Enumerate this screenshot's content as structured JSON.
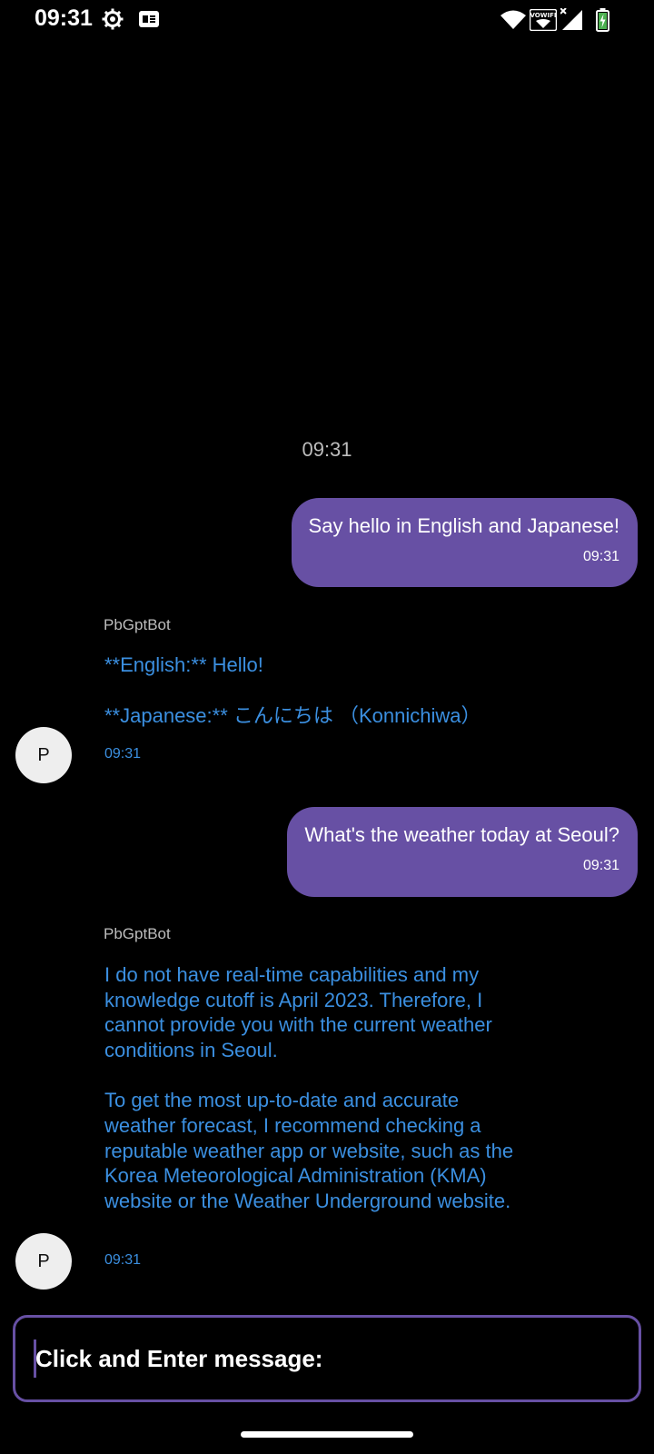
{
  "status_bar": {
    "time": "09:31",
    "icons": [
      "settings-gear-icon",
      "notification-badge-icon",
      "wifi-icon",
      "vowifi-icon",
      "signal-icon",
      "battery-charging-icon"
    ],
    "vowifi_label": "VOWIFI"
  },
  "chat": {
    "date_stamp": "09:31",
    "messages": [
      {
        "type": "outgoing",
        "text": "Say hello in English and Japanese!",
        "time": "09:31"
      },
      {
        "type": "incoming",
        "sender": "PbGptBot",
        "avatar": "P",
        "paragraphs": [
          "**English:** Hello!",
          "**Japanese:** こんにちは （Konnichiwa）"
        ],
        "time": "09:31"
      },
      {
        "type": "outgoing",
        "text": "What's the weather today at Seoul?",
        "time": "09:31"
      },
      {
        "type": "incoming",
        "sender": "PbGptBot",
        "avatar": "P",
        "paragraphs": [
          "I do not have real-time capabilities and my knowledge cutoff is April 2023. Therefore, I cannot provide you with the current weather conditions in Seoul.",
          "To get the most up-to-date and accurate weather forecast, I recommend checking a reputable weather app or website, such as the Korea Meteorological Administration (KMA) website or the Weather Underground website."
        ],
        "time": "09:31"
      }
    ]
  },
  "composer": {
    "placeholder": "Click and Enter message:"
  },
  "colors": {
    "background": "#000000",
    "outgoing_bubble": "#6750a4",
    "bot_text": "#3b8fe0",
    "muted_text": "#bdbdbd"
  }
}
